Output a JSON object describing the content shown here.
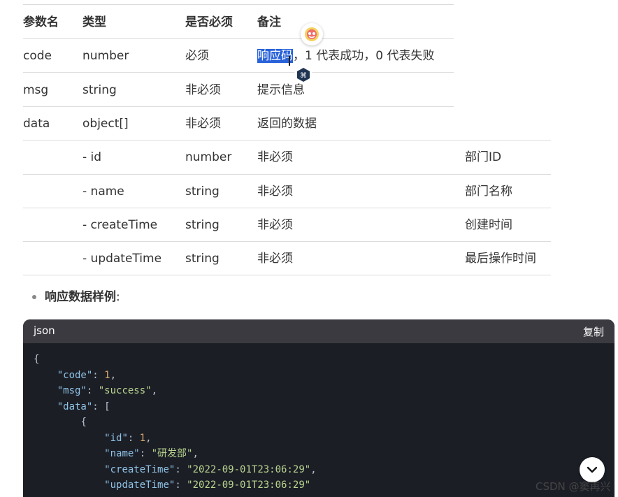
{
  "table": {
    "headers": [
      "参数名",
      "类型",
      "是否必须",
      "备注"
    ],
    "rows": [
      {
        "name": "code",
        "type": "number",
        "required": "必须",
        "remark_selected": "响应码",
        "remark_rest": "，1 代表成功，0 代表失败"
      },
      {
        "name": "msg",
        "type": "string",
        "required": "非必须",
        "remark": "提示信息"
      },
      {
        "name": "data",
        "type": "object[]",
        "required": "非必须",
        "remark": "返回的数据"
      }
    ],
    "sub_rows": [
      {
        "name": "- id",
        "type": "number",
        "required": "非必须",
        "remark": "部门ID"
      },
      {
        "name": "- name",
        "type": "string",
        "required": "非必须",
        "remark": "部门名称"
      },
      {
        "name": "- createTime",
        "type": "string",
        "required": "非必须",
        "remark": "创建时间"
      },
      {
        "name": "- updateTime",
        "type": "string",
        "required": "非必须",
        "remark": "最后操作时间"
      }
    ]
  },
  "section": {
    "bullet_label": "响应数据样例",
    "bullet_suffix": ":"
  },
  "code": {
    "lang": "json",
    "copy_label": "复制",
    "lines": {
      "l1": "{",
      "code_key": "\"code\"",
      "code_val": "1",
      "msg_key": "\"msg\"",
      "msg_val": "\"success\"",
      "data_key": "\"data\"",
      "data_open": "[",
      "obj_open": "{",
      "id_key": "\"id\"",
      "id_val": "1",
      "name_key": "\"name\"",
      "name_val": "\"研发部\"",
      "ct_key": "\"createTime\"",
      "ct_val": "\"2022-09-01T23:06:29\"",
      "ut_key": "\"updateTime\"",
      "ut_val": "\"2022-09-01T23:06:29\""
    }
  },
  "watermark": "CSDN @窦再兴",
  "icons": {
    "floating_top": "assistant-logo-icon",
    "floating_mid": "translate-icon",
    "scroll": "chevron-down-icon"
  }
}
